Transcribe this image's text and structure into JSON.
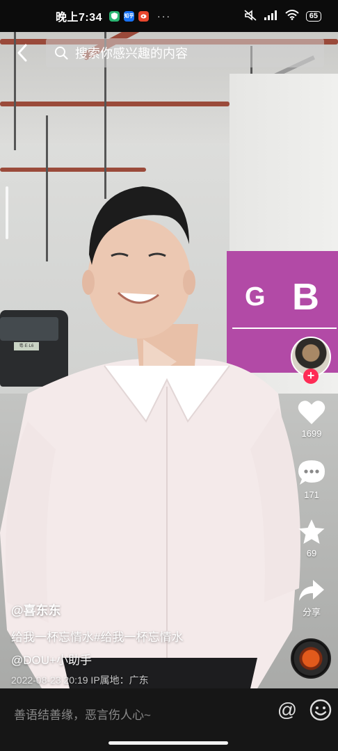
{
  "status_bar": {
    "time": "晚上7:34",
    "apps": [
      {
        "name": "shield-app-icon",
        "label": "",
        "color": "#2bb673"
      },
      {
        "name": "zhihu-app-icon",
        "label": "知乎",
        "color": "#1772f6"
      },
      {
        "name": "weibo-app-icon",
        "label": "",
        "color": "#e8472d"
      }
    ],
    "more": "···",
    "battery": "65"
  },
  "search": {
    "placeholder": "搜索你感兴趣的内容"
  },
  "rail": {
    "likes": "1699",
    "comments": "171",
    "favorites": "69",
    "share_label": "分享"
  },
  "video": {
    "column_letters": [
      "G",
      "B"
    ],
    "plate": "粤·E·L6"
  },
  "caption": {
    "author": "@喜东东",
    "description": "给我一杯忘情水#给我一杯忘情水",
    "mention": "@DOU+小助手",
    "meta": "2022-08-23 20:19  IP属地：广东"
  },
  "comment_bar": {
    "placeholder": "善语结善缘，恶言伤人心~",
    "at_symbol": "@"
  },
  "colors": {
    "follow": "#fe2c55",
    "purple_band": "#b24aa6"
  }
}
